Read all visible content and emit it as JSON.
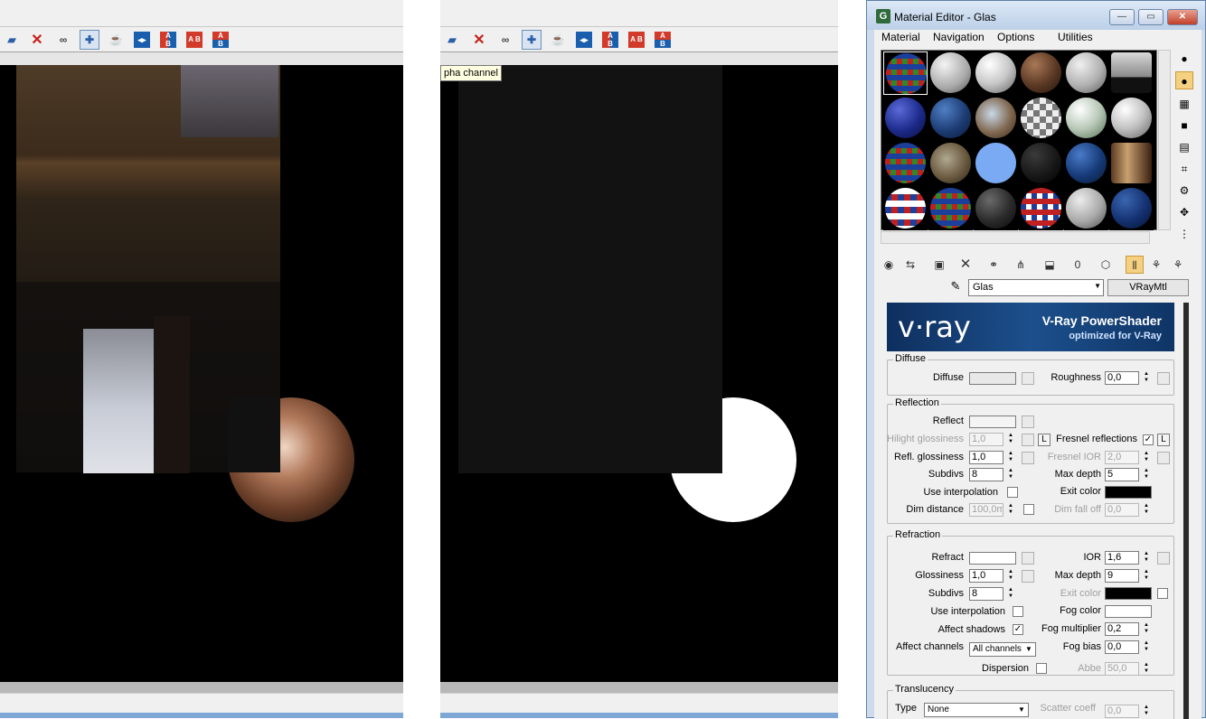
{
  "left_render": {
    "toolbar": [
      "open-icon",
      "delete-icon",
      "clone-icon",
      "alpha-channel-icon",
      "teapot-icon",
      "compare-icon",
      "ab-icon",
      "ab-icon",
      "ab-icon"
    ]
  },
  "right_render": {
    "tooltip": "pha channel"
  },
  "material_editor": {
    "title": "Material Editor - Glas",
    "window_buttons": {
      "minimize": "—",
      "maximize": "▭",
      "close": "✕"
    },
    "menu": [
      "Material",
      "Navigation",
      "Options",
      "Utilities"
    ],
    "material_name": "Glas",
    "material_type": "VRayMtl",
    "banner": {
      "logo": "v·ray",
      "title": "V-Ray PowerShader",
      "subtitle": "optimized for V-Ray"
    },
    "diffuse": {
      "group": "Diffuse",
      "diffuse_label": "Diffuse",
      "roughness_label": "Roughness",
      "roughness": "0,0"
    },
    "reflection": {
      "group": "Reflection",
      "reflect_label": "Reflect",
      "hilight_label": "Hilight glossiness",
      "hilight": "1,0",
      "l1": "L",
      "fresnel_label": "Fresnel reflections",
      "l2": "L",
      "refl_gloss_label": "Refl. glossiness",
      "refl_gloss": "1,0",
      "fresnel_ior_label": "Fresnel IOR",
      "fresnel_ior": "2,0",
      "subdivs_label": "Subdivs",
      "subdivs": "8",
      "maxdepth_label": "Max depth",
      "maxdepth": "5",
      "use_interp_label": "Use interpolation",
      "exit_color_label": "Exit color",
      "dim_distance_label": "Dim distance",
      "dim_distance": "100,0m",
      "dim_falloff_label": "Dim fall off",
      "dim_falloff": "0,0"
    },
    "refraction": {
      "group": "Refraction",
      "refract_label": "Refract",
      "ior_label": "IOR",
      "ior": "1,6",
      "gloss_label": "Glossiness",
      "gloss": "1,0",
      "maxdepth_label": "Max depth",
      "maxdepth": "9",
      "subdivs_label": "Subdivs",
      "subdivs": "8",
      "exit_color_label": "Exit color",
      "use_interp_label": "Use interpolation",
      "fog_color_label": "Fog color",
      "affect_shadows_label": "Affect shadows",
      "fog_mult_label": "Fog multiplier",
      "fog_mult": "0,2",
      "affect_channels_label": "Affect channels",
      "affect_channels": "All channels",
      "fog_bias_label": "Fog bias",
      "fog_bias": "0,0",
      "dispersion_label": "Dispersion",
      "abbe_label": "Abbe",
      "abbe": "50,0"
    },
    "translucency": {
      "group": "Translucency",
      "type_label": "Type",
      "type": "None",
      "scatter_label": "Scatter coeff",
      "scatter": "0,0"
    },
    "checkmark": "✓",
    "colors": {
      "fog_color": "#ffffff",
      "exit_color": "#000000",
      "diffuse": "#e8e8e8"
    }
  }
}
